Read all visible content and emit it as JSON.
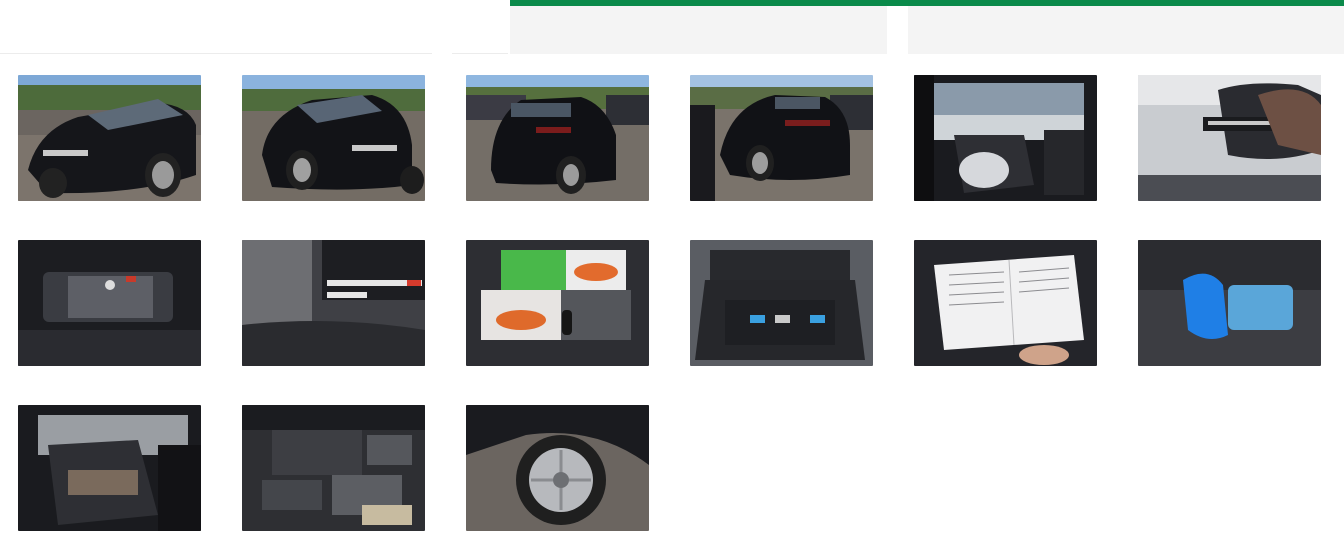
{
  "colors": {
    "accent": "#0a8a4a",
    "panel": "#f4f4f4"
  },
  "gallery": {
    "images": [
      {
        "subject": "car-front-left"
      },
      {
        "subject": "car-front-right"
      },
      {
        "subject": "car-rear-right"
      },
      {
        "subject": "car-rear-left"
      },
      {
        "subject": "interior-driver-door"
      },
      {
        "subject": "windshield-vin-sticker"
      },
      {
        "subject": "instrument-cluster"
      },
      {
        "subject": "odometer-display"
      },
      {
        "subject": "documents-and-key"
      },
      {
        "subject": "trunk"
      },
      {
        "subject": "service-booklet"
      },
      {
        "subject": "rear-seat-items"
      },
      {
        "subject": "rear-seats"
      },
      {
        "subject": "engine-bay"
      },
      {
        "subject": "wheel-rim"
      }
    ]
  }
}
